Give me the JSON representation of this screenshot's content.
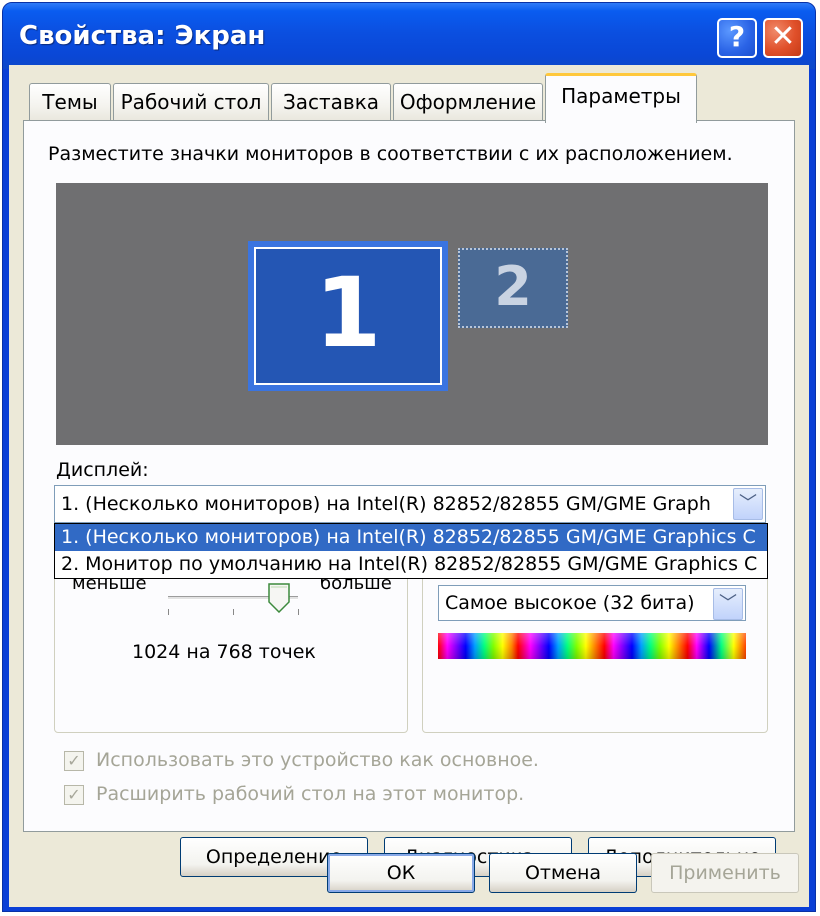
{
  "window": {
    "title": "Свойства: Экран",
    "help_glyph": "?",
    "close_glyph": "✕"
  },
  "tabs": [
    {
      "label": "Темы",
      "active": false
    },
    {
      "label": "Рабочий стол",
      "active": false
    },
    {
      "label": "Заставка",
      "active": false
    },
    {
      "label": "Оформление",
      "active": false
    },
    {
      "label": "Параметры",
      "active": true
    }
  ],
  "settings": {
    "instruction": "Разместите значки мониторов в соответствии с их расположением.",
    "monitors": [
      {
        "number": "1",
        "selected": true
      },
      {
        "number": "2",
        "selected": false
      }
    ],
    "display_label": "Дисплей:",
    "display_value": "1. (Несколько мониторов) на Intel(R) 82852/82855 GM/GME Graph",
    "display_options": [
      "1. (Несколько мониторов) на Intel(R) 82852/82855 GM/GME Graphics C",
      "2. Монитор по умолчанию на Intel(R) 82852/82855 GM/GME Graphics C"
    ],
    "resolution": {
      "less_label": "меньше",
      "more_label": "больше",
      "value_text": "1024 на 768 точек",
      "level": 0.85
    },
    "color_quality": {
      "value": "Самое высокое (32 бита)"
    },
    "checkbox_primary": {
      "label": "Использовать это устройство как основное.",
      "checked": true,
      "glyph": "✓"
    },
    "checkbox_extend": {
      "label": "Расширить рабочий стол на этот монитор.",
      "checked": true,
      "glyph": "✓"
    },
    "buttons": {
      "identify": "Определение",
      "troubleshoot": "Диагностика...",
      "advanced": "Дополнительно"
    },
    "dropdown_arrow_glyph": "﹀"
  },
  "footer": {
    "ok": "ОК",
    "cancel": "Отмена",
    "apply": "Применить"
  },
  "colors": {
    "titlebar": "#0a4fe0",
    "selection": "#316ac5",
    "dialog_bg": "#ece9d8",
    "active_tab_accent": "#ffc83c"
  }
}
